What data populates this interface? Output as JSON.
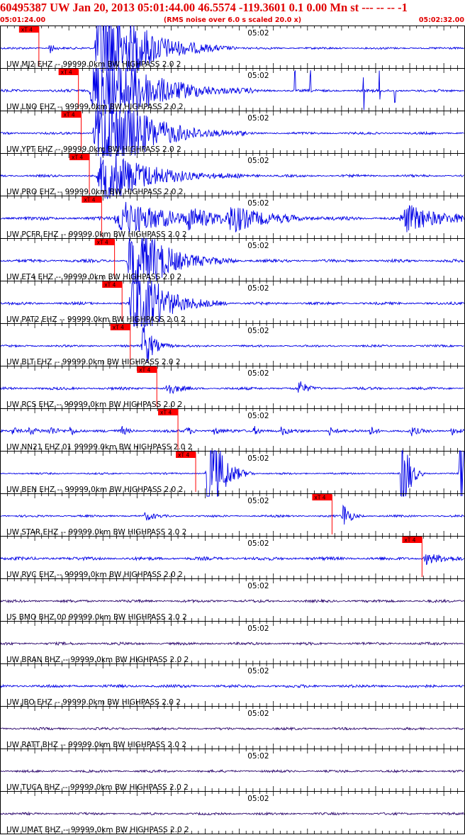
{
  "header": {
    "title": "60495387 UW Jan 20, 2013 05:01:44.00   46.5574 -119.3601  0.1 0.00 Mn st --- -- --   -1",
    "start_time": "05:01:24.00",
    "note": "(RMS noise over 6.0 s scaled 20.0 x)",
    "end_time": "05:02:32.00"
  },
  "colors": {
    "trace": "#0000e6",
    "trace_broadband": "#2e0a6e",
    "pick": "#ff0000",
    "grid": "#000000",
    "text": "#000000",
    "header": "#e00000"
  },
  "chart_data": {
    "type": "line",
    "x_unit": "seconds after 05:01:24.00",
    "xlim": [
      0,
      68
    ],
    "minute_tick_label": "05:02",
    "minute_tick_time": 36,
    "pick_label": "xT 4",
    "traces": [
      {
        "label": "UW MJ2 EHZ -- 99999.0km BW  HIGHPASS  2.0  2",
        "pick_time": 5.6,
        "noise": 0.35,
        "kind": "sp",
        "bursts": [
          {
            "t0": 7,
            "dur": 0.8,
            "amp": 3
          },
          {
            "t0": 13.7,
            "dur": 7,
            "amp": 30
          }
        ]
      },
      {
        "label": "UW LNO EHZ -- 99999.0km BW  HIGHPASS  2.0  2",
        "pick_time": 11.4,
        "noise": 0.45,
        "kind": "sp",
        "bursts": [
          {
            "t0": 13,
            "dur": 8,
            "amp": 28
          }
        ],
        "spikes": [
          43.2,
          45.4,
          53.2,
          55.6,
          57.8
        ]
      },
      {
        "label": "UW YPT EHZ -- 99999.0km BW  HIGHPASS  2.0  2",
        "pick_time": 11.8,
        "noise": 0.4,
        "kind": "sp",
        "bursts": [
          {
            "t0": 13.5,
            "dur": 7.5,
            "amp": 28
          }
        ]
      },
      {
        "label": "UW PRO EHZ -- 99999.0km BW  HIGHPASS  2.0  2",
        "pick_time": 13.0,
        "noise": 0.4,
        "kind": "sp",
        "bursts": [
          {
            "t0": 14,
            "dur": 8,
            "amp": 14
          }
        ]
      },
      {
        "label": "UW PCFR EHZ -- 99999.0km BW  HIGHPASS  2.0  2",
        "pick_time": 14.8,
        "noise": 0.55,
        "kind": "sp",
        "bursts": [
          {
            "t0": 16.5,
            "dur": 9,
            "amp": 8
          },
          {
            "t0": 27,
            "dur": 4,
            "amp": 4
          },
          {
            "t0": 33,
            "dur": 6,
            "amp": 5.5
          },
          {
            "t0": 58.5,
            "dur": 7,
            "amp": 6
          }
        ]
      },
      {
        "label": "UW ET4 EHZ -- 99999.0km BW  HIGHPASS  2.0  2",
        "pick_time": 16.7,
        "noise": 0.5,
        "kind": "sp",
        "bursts": [
          {
            "t0": 18.5,
            "dur": 5.5,
            "amp": 22
          }
        ]
      },
      {
        "label": "UW PAT2 EHZ -- 99999.0km BW  HIGHPASS  2.0  2",
        "pick_time": 17.8,
        "noise": 0.45,
        "kind": "sp",
        "bursts": [
          {
            "t0": 18.8,
            "dur": 4.8,
            "amp": 24
          }
        ]
      },
      {
        "label": "UW BLT EHZ -- 99999.0km BW  HIGHPASS  2.0  2",
        "pick_time": 19.0,
        "noise": 0.35,
        "kind": "sp",
        "bursts": [
          {
            "t0": 20.6,
            "dur": 1.8,
            "amp": 12
          }
        ]
      },
      {
        "label": "UW RCS EHZ -- 99999.0km BW  HIGHPASS  2.0  2",
        "pick_time": 22.9,
        "noise": 0.45,
        "kind": "sp",
        "bursts": [
          {
            "t0": 24,
            "dur": 1.6,
            "amp": 4
          },
          {
            "t0": 43.5,
            "dur": 1.2,
            "amp": 4
          }
        ]
      },
      {
        "label": "UW NN21 EHZ 01 99999.0km BW  HIGHPASS  2.0  2",
        "pick_time": 26.0,
        "noise": 0.45,
        "kind": "sp",
        "bursts": [
          {
            "t0": 1.5,
            "dur": 1.2,
            "amp": 2
          },
          {
            "t0": 4,
            "dur": 1.2,
            "amp": 2
          },
          {
            "t0": 7,
            "dur": 1.2,
            "amp": 2
          },
          {
            "t0": 10,
            "dur": 1.2,
            "amp": 2
          },
          {
            "t0": 17.5,
            "dur": 1.2,
            "amp": 2
          },
          {
            "t0": 27,
            "dur": 1.2,
            "amp": 2
          },
          {
            "t0": 31,
            "dur": 1.2,
            "amp": 2
          },
          {
            "t0": 37,
            "dur": 1.2,
            "amp": 2
          },
          {
            "t0": 41,
            "dur": 1.2,
            "amp": 2
          },
          {
            "t0": 48,
            "dur": 1.2,
            "amp": 2
          },
          {
            "t0": 54,
            "dur": 1.2,
            "amp": 2
          },
          {
            "t0": 60,
            "dur": 1.2,
            "amp": 2
          },
          {
            "t0": 66,
            "dur": 1.2,
            "amp": 2
          }
        ]
      },
      {
        "label": "UW BEN EHZ -- 99999.0km BW  HIGHPASS  2.0  2",
        "pick_time": 28.6,
        "noise": 0.3,
        "kind": "sp",
        "bursts": [
          {
            "t0": 30,
            "dur": 2.4,
            "amp": 30
          },
          {
            "t0": 58.6,
            "dur": 1.2,
            "amp": 30
          },
          {
            "t0": 67.2,
            "dur": 0.8,
            "amp": 30
          }
        ]
      },
      {
        "label": "UW STAR EHZ -- 99999.0km BW  HIGHPASS  2.0  2",
        "pick_time": 48.6,
        "noise": 0.35,
        "kind": "sp",
        "bursts": [
          {
            "t0": 21,
            "dur": 1.6,
            "amp": 2
          },
          {
            "t0": 50,
            "dur": 1.2,
            "amp": 7
          }
        ]
      },
      {
        "label": "UW RVC EHZ -- 99999.0km BW  HIGHPASS  2.0  2",
        "pick_time": 61.8,
        "noise": 0.55,
        "kind": "sp",
        "bursts": [
          {
            "t0": 62,
            "dur": 3,
            "amp": 2.5
          }
        ]
      },
      {
        "label": "US BMO BHZ 00 99999.0km BW  HIGHPASS  2.0  2",
        "pick_time": null,
        "noise": 0.45,
        "kind": "bb",
        "bursts": []
      },
      {
        "label": "UW BRAN BHZ -- 99999.0km BW  HIGHPASS  2.0  2",
        "pick_time": null,
        "noise": 0.45,
        "kind": "bb",
        "bursts": []
      },
      {
        "label": "UW JBO EHZ -- 99999.0km BW  HIGHPASS  2.0  2",
        "pick_time": null,
        "noise": 0.5,
        "kind": "sp",
        "bursts": []
      },
      {
        "label": "UW RATT BHZ -- 99999.0km BW  HIGHPASS  2.0  2",
        "pick_time": null,
        "noise": 0.4,
        "kind": "bb",
        "bursts": []
      },
      {
        "label": "UW TUCA BHZ -- 99999.0km BW  HIGHPASS  2.0  2",
        "pick_time": null,
        "noise": 0.4,
        "kind": "bb",
        "bursts": []
      },
      {
        "label": "UW UMAT BHZ -- 99999.0km BW  HIGHPASS  2.0  2",
        "pick_time": null,
        "noise": 0.4,
        "kind": "bb",
        "bursts": []
      }
    ]
  }
}
